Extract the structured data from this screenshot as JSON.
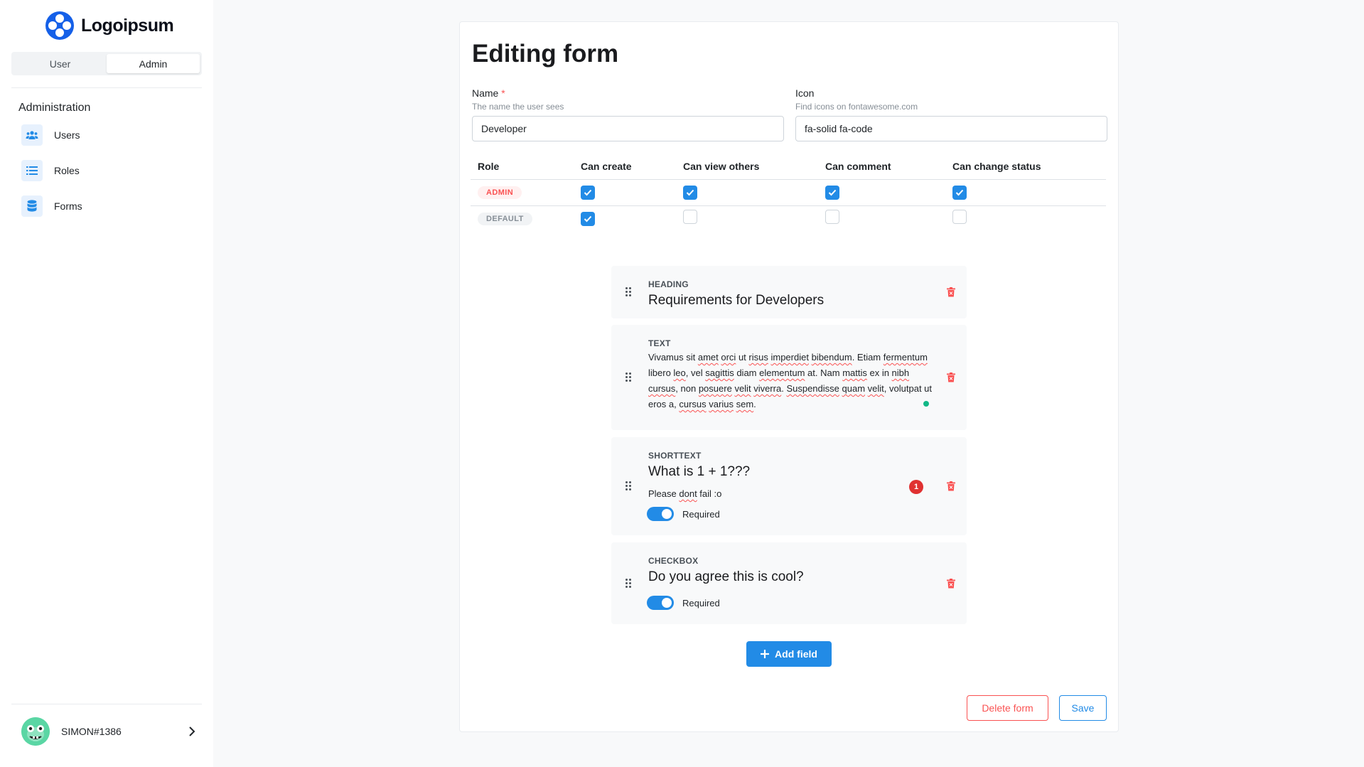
{
  "brand": {
    "name": "Logoipsum",
    "color": "#1560e8"
  },
  "mode_switch": {
    "options": [
      "User",
      "Admin"
    ],
    "selected": "Admin"
  },
  "sidebar": {
    "section_title": "Administration",
    "items": [
      {
        "label": "Users",
        "icon": "users-icon"
      },
      {
        "label": "Roles",
        "icon": "list-icon"
      },
      {
        "label": "Forms",
        "icon": "database-icon"
      }
    ]
  },
  "user": {
    "name": "SIMON#1386",
    "avatar": "avatar"
  },
  "form": {
    "title": "Editing form",
    "name_field": {
      "label": "Name",
      "required_mark": "*",
      "description": "The name the user sees",
      "value": "Developer"
    },
    "icon_field": {
      "label": "Icon",
      "description": "Find icons on fontawesome.com",
      "value": "fa-solid fa-code"
    },
    "permissions": {
      "headers": [
        "Role",
        "Can create",
        "Can view others",
        "Can comment",
        "Can change status"
      ],
      "rows": [
        {
          "role": "ADMIN",
          "can_create": true,
          "can_view_others": true,
          "can_comment": true,
          "can_change_status": true
        },
        {
          "role": "DEFAULT",
          "can_create": true,
          "can_view_others": false,
          "can_comment": false,
          "can_change_status": false
        }
      ]
    },
    "fields": {
      "heading": {
        "type": "HEADING",
        "title": "Requirements for Developers"
      },
      "text": {
        "type": "TEXT",
        "body": "Vivamus sit amet orci ut risus imperdiet bibendum. Etiam fermentum libero leo, vel sagittis diam elementum at. Nam mattis ex in nibh cursus, non posuere velit viverra. Suspendisse quam velit, volutpat ut eros a, cursus varius sem."
      },
      "shorttext": {
        "type": "SHORTTEXT",
        "title": "What is 1 + 1???",
        "description": "Please dont fail :o",
        "required_label": "Required",
        "required": true,
        "badge_count": "1"
      },
      "checkbox": {
        "type": "CHECKBOX",
        "title": "Do you agree this is cool?",
        "required_label": "Required",
        "required": true
      }
    },
    "add_field_label": "Add field",
    "delete_label": "Delete form",
    "save_label": "Save"
  },
  "colors": {
    "primary": "#228be6",
    "danger": "#fa5252",
    "background": "#f8f9fa"
  }
}
